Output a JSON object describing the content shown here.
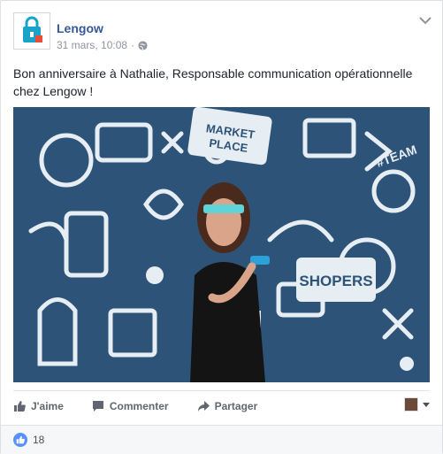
{
  "post": {
    "page_name": "Lengow",
    "timestamp": "31 mars, 10:08",
    "separator": "·",
    "audience_icon": "globe-icon",
    "text": "Bon anniversaire à Nathalie, Responsable communication opérationnelle chez Lengow !"
  },
  "photo": {
    "wall_labels": [
      "MARKET PLACE",
      "SHOPERS",
      "TEAM"
    ]
  },
  "actions": {
    "like_label": "J'aime",
    "comment_label": "Commenter",
    "share_label": "Partager"
  },
  "footer": {
    "like_count": "18"
  },
  "colors": {
    "link_blue": "#365899",
    "like_blue": "#5890ff",
    "muted": "#90949c"
  }
}
